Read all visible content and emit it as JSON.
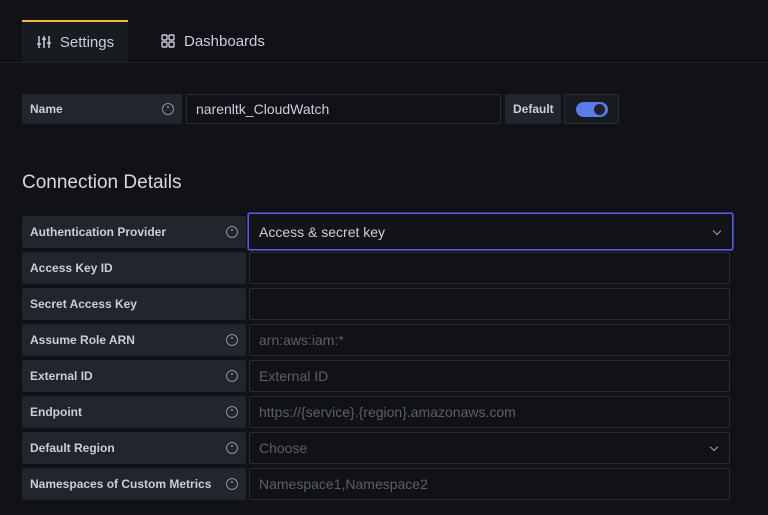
{
  "tabs": [
    {
      "label": "Settings",
      "icon": "sliders-icon",
      "active": true
    },
    {
      "label": "Dashboards",
      "icon": "grid-icon",
      "active": false
    }
  ],
  "name_row": {
    "label": "Name",
    "value": "narenltk_CloudWatch",
    "default_label": "Default",
    "default_on": true
  },
  "section_title": "Connection Details",
  "fields": {
    "auth_provider": {
      "label": "Authentication Provider",
      "value": "Access & secret key"
    },
    "access_key": {
      "label": "Access Key ID",
      "value": ""
    },
    "secret_key": {
      "label": "Secret Access Key",
      "value": ""
    },
    "assume_role": {
      "label": "Assume Role ARN",
      "placeholder": "arn:aws:iam:*"
    },
    "external_id": {
      "label": "External ID",
      "placeholder": "External ID"
    },
    "endpoint": {
      "label": "Endpoint",
      "placeholder": "https://{service}.{region}.amazonaws.com"
    },
    "default_region": {
      "label": "Default Region",
      "placeholder": "Choose"
    },
    "namespaces": {
      "label": "Namespaces of Custom Metrics",
      "placeholder": "Namespace1,Namespace2"
    }
  },
  "colors": {
    "accent": "#5b5bd6",
    "tab_active": "#f5b73d",
    "toggle": "#5d7be6"
  }
}
